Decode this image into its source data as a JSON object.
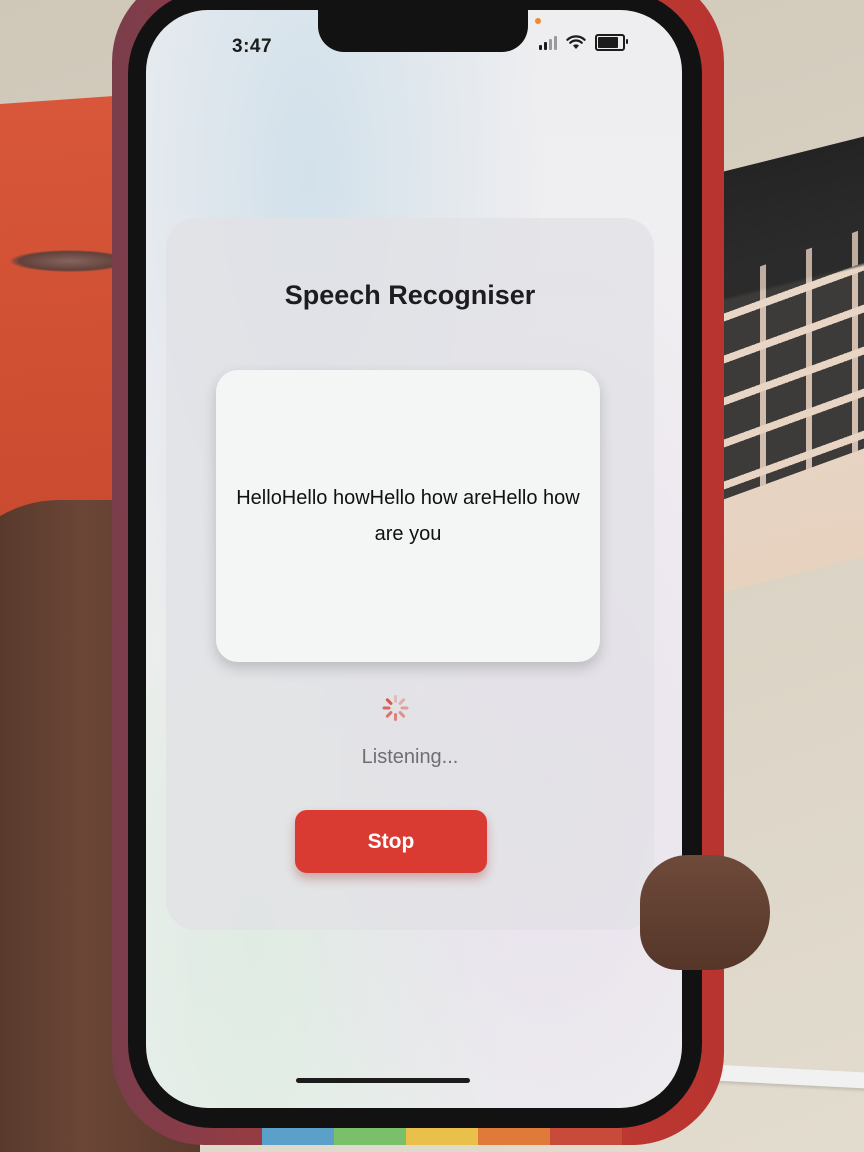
{
  "status_bar": {
    "time": "3:47",
    "signal_icon": "cellular-signal-icon",
    "wifi_icon": "wifi-icon",
    "battery_icon": "battery-icon",
    "battery_level": 0.85
  },
  "app": {
    "title": "Speech Recogniser",
    "transcript": "HelloHello howHello how areHello how are you",
    "activity_icon": "loading-spinner-icon",
    "status": "Listening...",
    "stop_label": "Stop"
  },
  "colors": {
    "accent": "#d93a32",
    "title": "#1d1d1f",
    "status_text": "#6e6e73",
    "transcript_bg": "#f4f5f5"
  }
}
